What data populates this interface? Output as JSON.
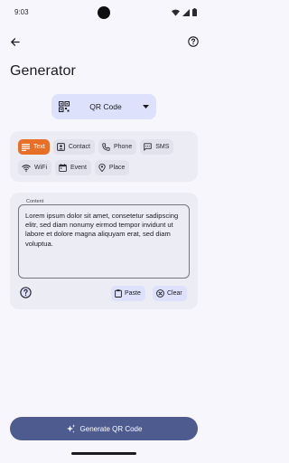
{
  "status": {
    "time": "9:03"
  },
  "toolbar": {
    "back_icon": "arrow-back-icon",
    "help_icon": "help-circle-icon"
  },
  "page": {
    "title": "Generator"
  },
  "type_selector": {
    "selected": "QR Code",
    "icon": "qr-code-icon"
  },
  "chips": [
    {
      "label": "Text",
      "icon": "text-lines-icon",
      "active": true
    },
    {
      "label": "Contact",
      "icon": "contact-card-icon",
      "active": false
    },
    {
      "label": "Phone",
      "icon": "phone-icon",
      "active": false
    },
    {
      "label": "SMS",
      "icon": "sms-icon",
      "active": false
    },
    {
      "label": "WiFi",
      "icon": "wifi-icon",
      "active": false
    },
    {
      "label": "Event",
      "icon": "calendar-icon",
      "active": false
    },
    {
      "label": "Place",
      "icon": "location-pin-icon",
      "active": false
    }
  ],
  "content": {
    "label": "Content",
    "value": "Lorem ipsum dolor sit amet, consetetur sadipscing elitr, sed diam nonumy eirmod tempor invidunt ut labore et dolore magna aliquyam erat, sed diam voluptua."
  },
  "actions": {
    "paste_label": "Paste",
    "clear_label": "Clear"
  },
  "generate": {
    "label": "Generate QR Code"
  },
  "colors": {
    "accent": "#e86f28",
    "primary": "#4e5b8f",
    "surface": "#ececf4",
    "background": "#f7f6fc"
  }
}
